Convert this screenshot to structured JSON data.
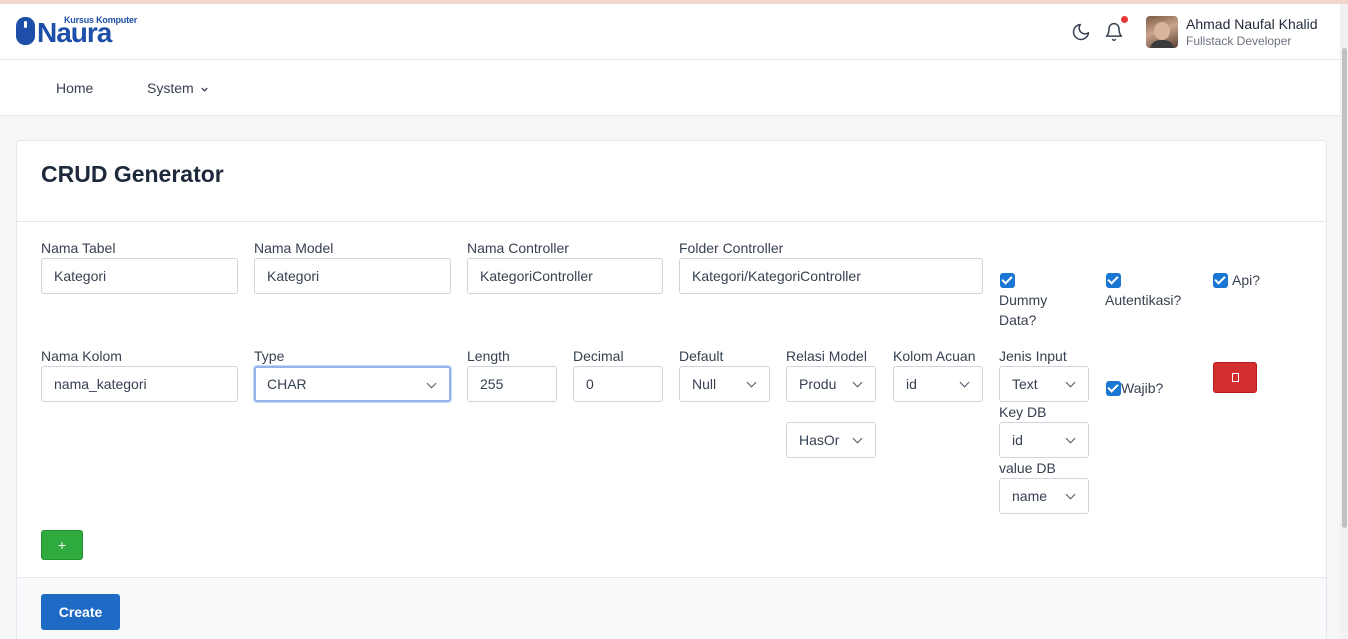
{
  "brand": {
    "small": "Kursus Komputer",
    "big": "Naura",
    "color": "#1d4fa8"
  },
  "header": {
    "icons": [
      "moon-icon",
      "bell-icon"
    ],
    "user": {
      "name": "Ahmad Naufal Khalid",
      "role": "Fullstack Developer"
    }
  },
  "nav": {
    "home": "Home",
    "system": "System"
  },
  "card": {
    "title": "CRUD Generator"
  },
  "form": {
    "nama_tabel": {
      "label": "Nama Tabel",
      "value": "Kategori"
    },
    "nama_model": {
      "label": "Nama Model",
      "value": "Kategori"
    },
    "nama_controller": {
      "label": "Nama Controller",
      "value": "KategoriController"
    },
    "folder_controller": {
      "label": "Folder Controller",
      "value": "Kategori/KategoriController"
    },
    "dummy": {
      "label1": "Dummy",
      "label2": "Data?",
      "checked": true
    },
    "autentikasi": {
      "label": "Autentikasi?",
      "checked": true
    },
    "api": {
      "label": "Api?",
      "checked": true
    }
  },
  "column": {
    "nama_kolom": {
      "label": "Nama Kolom",
      "value": "nama_kategori"
    },
    "type": {
      "label": "Type",
      "value": "CHAR"
    },
    "length": {
      "label": "Length",
      "value": "255"
    },
    "decimal": {
      "label": "Decimal",
      "value": "0"
    },
    "default": {
      "label": "Default",
      "value": "Null"
    },
    "relasi_model": {
      "label": "Relasi Model",
      "value": "Produ",
      "relation": "HasOr"
    },
    "kolom_acuan": {
      "label": "Kolom Acuan",
      "value": "id"
    },
    "jenis_input": {
      "label": "Jenis Input",
      "value": "Text"
    },
    "key_db": {
      "label": "Key DB",
      "value": "id"
    },
    "value_db": {
      "label": "value DB",
      "value": "name"
    },
    "wajib": {
      "label": "Wajib?",
      "checked": true
    }
  },
  "buttons": {
    "add": "+",
    "create": "Create"
  },
  "colors": {
    "primary": "#1f6ac4",
    "success": "#2eaa3e",
    "danger": "#d32f2f",
    "checkbox": "#1976d2"
  }
}
